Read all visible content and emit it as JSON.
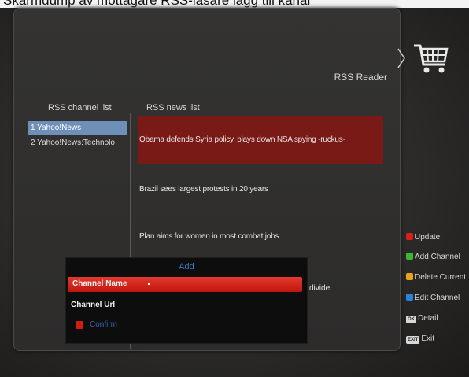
{
  "page": {
    "caption": "Skärmdump av mottagare RSS-läsare lägg till kanal"
  },
  "screen": {
    "title": "RSS Reader",
    "channel_list_header": "RSS channel list",
    "news_list_header": "RSS news list"
  },
  "channels": [
    {
      "label": "1  Yahoo!News",
      "selected": true
    },
    {
      "label": "2  Yahoo!News:Technolo",
      "selected": false
    }
  ],
  "news": [
    {
      "label": "Obama defends Syria policy, plays down NSA spying -ruckus-",
      "selected": true
    },
    {
      "label": "Brazil sees largest protests in 20 years",
      "selected": false
    },
    {
      "label": "Plan aims for women in most combat jobs",
      "selected": false
    },
    {
      "label": "divide",
      "selected": false
    }
  ],
  "legend": [
    {
      "key_color": "#d6201a",
      "label": "Update"
    },
    {
      "key_color": "#3bb534",
      "label": "Add Channel"
    },
    {
      "key_color": "#e8a21e",
      "label": "Delete Current"
    },
    {
      "key_color": "#2c82d8",
      "label": "Edit Channel"
    },
    {
      "key_text": "OK",
      "label": "Detail"
    },
    {
      "key_text": "EXIT",
      "label": "Exit"
    }
  ],
  "dialog": {
    "title": "Add",
    "channel_name_label": "Channel Name",
    "channel_url_label": "Channel Url",
    "confirm_label": "Confirm"
  },
  "icons": {
    "cart": "shopping-cart-icon"
  },
  "colors": {
    "selection_red": "#7a1a16",
    "channel_selection_blue": "#6e8fb8",
    "dialog_accent_blue": "#3d78c6"
  }
}
